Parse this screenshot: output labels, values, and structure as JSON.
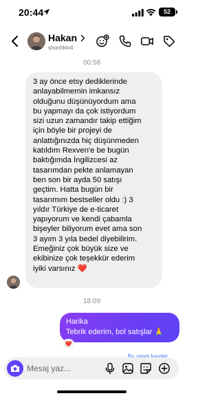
{
  "status_bar": {
    "time": "20:44",
    "battery": "52"
  },
  "header": {
    "name": "Hakan",
    "handle": "shonhkin4"
  },
  "messages": {
    "timestamp_1": "00:58",
    "incoming_text": "3 ay önce etsy dediklerinde\nanlayabilmemin imkansız\nolduğunu düşünüyordum ama\nbu yapmayı da çok istiyordum\nsizi uzun zamandır takip ettiğim\niçin böyle bir projeyi de\nanlattığınızda hiç düşünmeden\nkatıldım Rexven'e be bugün\nbaktığımda İngilizcesi az\ntasarımdan pekte anlamayan\nben son bir ayda 50 satışı\ngeçtim. Hatta bugün bir\ntasarımım bestseller oldu :) 3\nyıldır Türkiye de e-ticaret\nyapıyorum ve kendi çabamla\nbişeyler biliyorum evet ama son\n3 ayım 3 yıla bedel diyebilirim.\nEmeğiniz çok büyük size ve\nekibinize çok teşekkür ederim\niyiki varsınız ❤️",
    "timestamp_2": "18:09",
    "outgoing_line_1": "Harika",
    "outgoing_line_2": "Tebrik ederim, bol satışlar 🙏",
    "reaction": "❤️",
    "seen_text": "Bu yanıtı kaydet"
  },
  "composer": {
    "placeholder": "Mesaj yaz..."
  },
  "colors": {
    "accent": "#5d43f6",
    "bubble_in": "#efefef",
    "timestamp": "#8e8e8e"
  }
}
